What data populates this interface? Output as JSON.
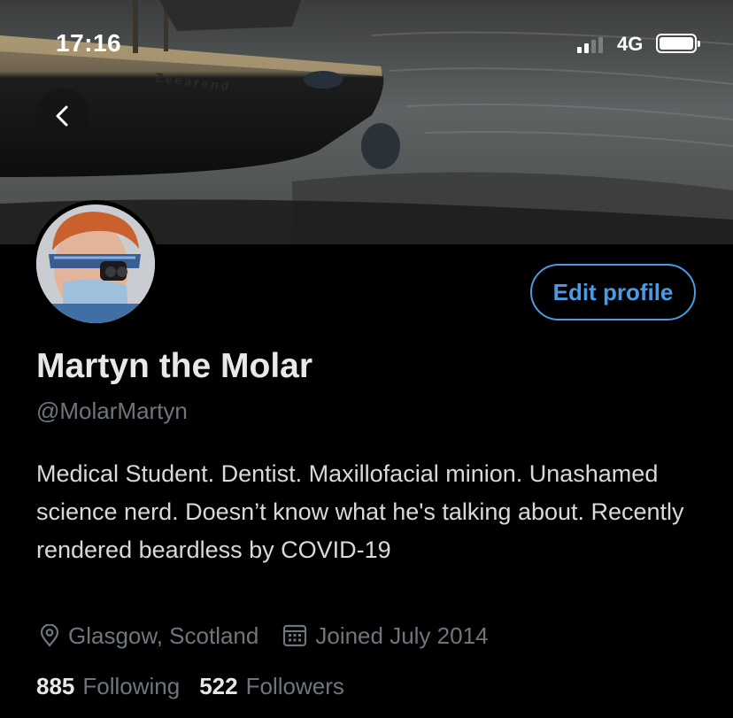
{
  "status_bar": {
    "time": "17:16",
    "network": "4G",
    "battery_level": 1.0
  },
  "banner": {
    "boat_name": "Zeearend"
  },
  "profile": {
    "display_name": "Martyn the Molar",
    "handle": "@MolarMartyn",
    "bio": "Medical Student. Dentist. Maxillofacial minion. Unashamed science nerd. Doesn’t know what he's talking about. Recently rendered beardless by COVID-19",
    "location": "Glasgow, Scotland",
    "joined": "Joined July 2014",
    "following_count": "885",
    "following_label": "Following",
    "followers_count": "522",
    "followers_label": "Followers"
  },
  "actions": {
    "edit_profile_label": "Edit profile"
  },
  "icons": {
    "back": "chevron-left-icon",
    "location": "location-pin-icon",
    "joined": "calendar-icon"
  },
  "colors": {
    "background": "#000000",
    "accent": "#4a9be6",
    "primary_text": "#e8e8e8",
    "secondary_text": "#6e767d"
  }
}
